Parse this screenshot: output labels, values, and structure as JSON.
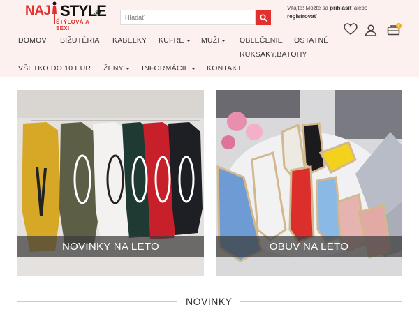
{
  "brand": {
    "name_part1": "NAJ",
    "name_part2": "STYLE",
    "tld": ".sk",
    "tagline": "ŠTÝLOVÁ A SEXI"
  },
  "search": {
    "placeholder": "Hľadať"
  },
  "login": {
    "prefix": "Vitajte! Môžte sa ",
    "login_link": "prihlásiť",
    "middle": " alebo",
    "register_link": "registrovať"
  },
  "header_icons": {
    "wishlist": "heart-icon",
    "account": "user-icon",
    "cart": "cart-icon",
    "cart_count": "0"
  },
  "nav": {
    "domov": "DOMOV",
    "bizuteria": "BIŽUTÉRIA",
    "kabelky": "KABELKY",
    "kufre": "KUFRE",
    "muzi": "MUŽI",
    "oblecenie": "OBLEČENIE",
    "ostatne": "OSTATNÉ",
    "ruksaky": "RUKSAKY,BATOHY",
    "vsetko": "VŠETKO DO 10 EUR",
    "zeny": "ŽENY",
    "informacie": "INFORMÁCIE",
    "kontakt": "KONTAKT"
  },
  "banners": [
    {
      "caption": "NOVINKY NA LETO"
    },
    {
      "caption": "OBUV NA LETO"
    }
  ],
  "section": {
    "title": "NOVINKY"
  },
  "colors": {
    "accent": "#e0312f",
    "header_bg": "#fdf1f0"
  }
}
